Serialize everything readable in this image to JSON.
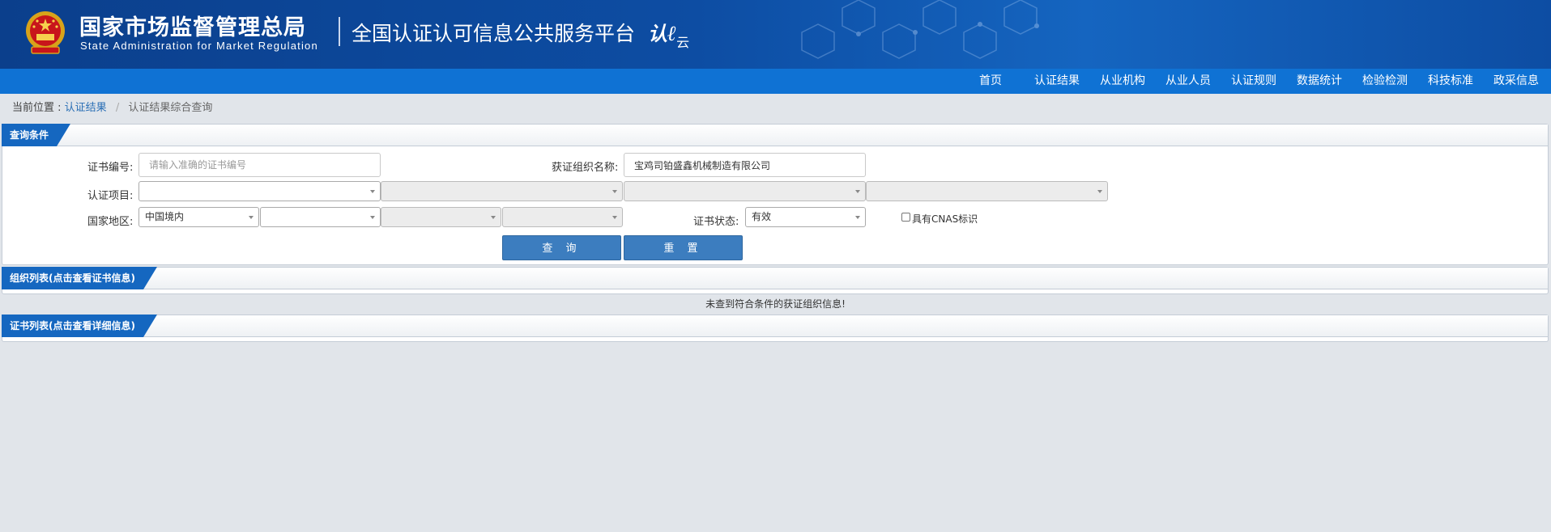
{
  "header": {
    "org_name_cn": "国家市场监督管理总局",
    "org_name_en": "State Administration  for  Market Regulation",
    "platform_title": "全国认证认可信息公共服务平台",
    "logo_main": "认",
    "logo_small": "云",
    "emblem_icon": "national-emblem-icon",
    "brand_color": "#0d4da3"
  },
  "nav": {
    "items": [
      "首页",
      "认证结果",
      "从业机构",
      "从业人员",
      "认证规则",
      "数据统计",
      "检验检测",
      "科技标准",
      "政采信息"
    ],
    "bar_color": "#0f72d4"
  },
  "breadcrumb": {
    "prefix": "当前位置 :",
    "link": "认证结果",
    "separator": "/",
    "current": "认证结果综合查询"
  },
  "query_panel": {
    "title": "查询条件",
    "cert_no_label": "证书编号:",
    "cert_no_placeholder": "请输入准确的证书编号",
    "cert_no_value": "",
    "org_name_label": "获证组织名称:",
    "org_name_value": "宝鸡司铂盛鑫机械制造有限公司",
    "project_label": "认证项目:",
    "project_selects": [
      "",
      "",
      "",
      ""
    ],
    "region_label": "国家地区:",
    "region_selects": [
      "中国境内",
      "",
      "",
      ""
    ],
    "status_label": "证书状态:",
    "status_value": "有效",
    "cnas_label": "具有CNAS标识",
    "cnas_checked": false,
    "query_button": "查 询",
    "reset_button": "重 置",
    "button_color": "#3c7dbf"
  },
  "org_panel": {
    "title": "组织列表(点击查看证书信息)",
    "empty_message": "未查到符合条件的获证组织信息!"
  },
  "cert_panel": {
    "title": "证书列表(点击查看详细信息)"
  }
}
